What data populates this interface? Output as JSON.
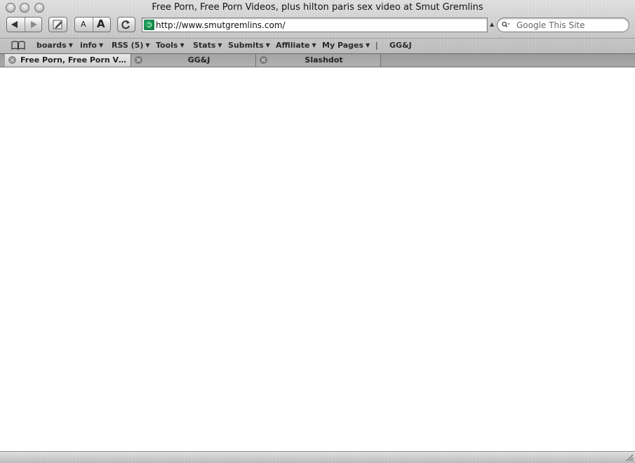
{
  "window": {
    "title": "Free Porn, Free Porn Videos, plus hilton paris sex video at Smut Gremlins"
  },
  "toolbar": {
    "text_smaller_label": "A",
    "text_bigger_label": "A",
    "address_value": "http://www.smutgremlins.com/",
    "search_placeholder": "Google This Site"
  },
  "bookmarks": {
    "items": [
      {
        "label": "boards",
        "has_menu": true
      },
      {
        "label": "info",
        "has_menu": true
      },
      {
        "label": "RSS (5)",
        "has_menu": true
      },
      {
        "label": "Tools",
        "has_menu": true
      },
      {
        "label": "Stats",
        "has_menu": true
      },
      {
        "label": "Submits",
        "has_menu": true
      },
      {
        "label": "Affiliate",
        "has_menu": true
      },
      {
        "label": "My Pages",
        "has_menu": true
      },
      {
        "label": "|",
        "has_menu": false
      },
      {
        "label": "GG&J",
        "has_menu": false
      }
    ],
    "menu_caret": "▼"
  },
  "tabs": [
    {
      "label": "Free Porn, Free Porn Videos, plus hilton paris sex video at Smut Gremlins",
      "active": true
    },
    {
      "label": "GG&J",
      "active": false
    },
    {
      "label": "Slashdot",
      "active": false
    }
  ]
}
